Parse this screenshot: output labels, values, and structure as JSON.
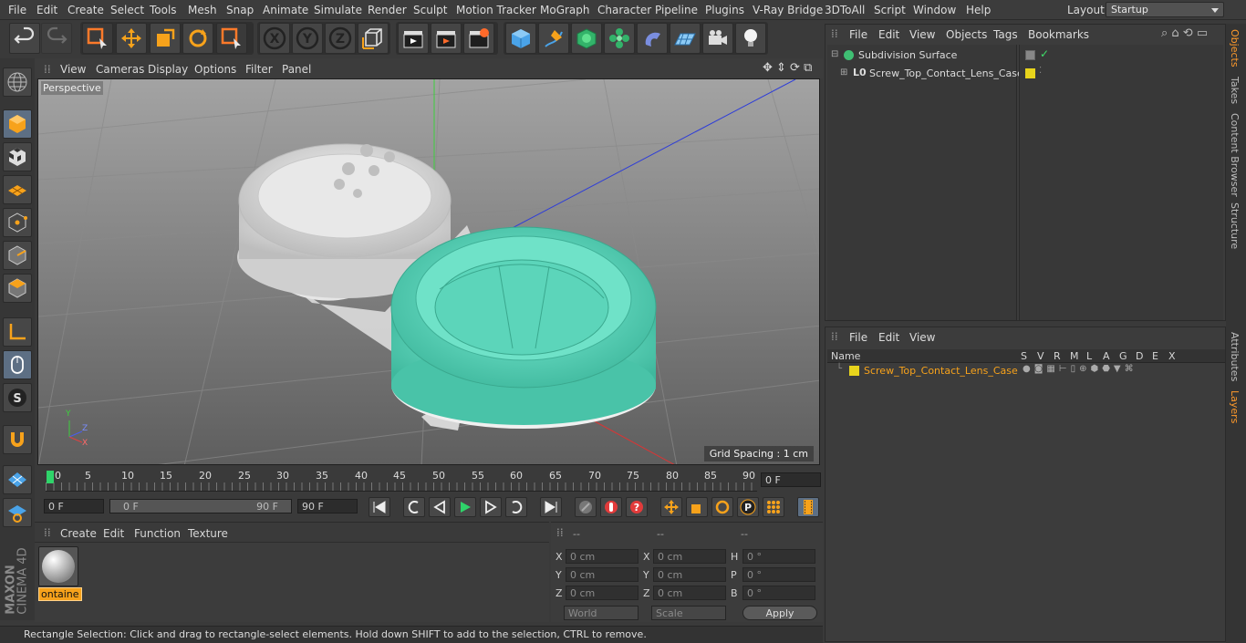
{
  "menubar": {
    "items": [
      "File",
      "Edit",
      "Create",
      "Select",
      "Tools",
      "Mesh",
      "Snap",
      "Animate",
      "Simulate",
      "Render",
      "Sculpt",
      "Motion Tracker",
      "MoGraph",
      "Character",
      "Pipeline",
      "Plugins",
      "V-Ray Bridge",
      "3DToAll",
      "Script",
      "Window",
      "Help"
    ],
    "layout_label": "Layout:",
    "layout_value": "Startup"
  },
  "viewport": {
    "menu": [
      "View",
      "Cameras",
      "Display",
      "Options",
      "Filter",
      "Panel"
    ],
    "label": "Perspective",
    "grid_spacing": "Grid Spacing : 1 cm",
    "axis_x": "X",
    "axis_y": "Y",
    "axis_z": "Z"
  },
  "timeline": {
    "ticks": [
      "0",
      "5",
      "10",
      "15",
      "20",
      "25",
      "30",
      "35",
      "40",
      "45",
      "50",
      "55",
      "60",
      "65",
      "70",
      "75",
      "80",
      "85",
      "90"
    ],
    "current_frame": "0 F",
    "start_field": "0 F",
    "range_start": "0 F",
    "range_end": "90 F",
    "end_field": "90 F"
  },
  "material": {
    "menu": [
      "Create",
      "Edit",
      "Function",
      "Texture"
    ],
    "item_label": "ontaine"
  },
  "coords": {
    "headers": [
      "--",
      "--",
      "--"
    ],
    "rows": [
      {
        "l1": "X",
        "v1": "0 cm",
        "l2": "X",
        "v2": "0 cm",
        "l3": "H",
        "v3": "0 °"
      },
      {
        "l1": "Y",
        "v1": "0 cm",
        "l2": "Y",
        "v2": "0 cm",
        "l3": "P",
        "v3": "0 °"
      },
      {
        "l1": "Z",
        "v1": "0 cm",
        "l2": "Z",
        "v2": "0 cm",
        "l3": "B",
        "v3": "0 °"
      }
    ],
    "world": "World",
    "scale": "Scale",
    "apply": "Apply"
  },
  "status": "Rectangle Selection: Click and drag to rectangle-select elements. Hold down SHIFT to add to the selection, CTRL to remove.",
  "objects": {
    "menu": [
      "File",
      "Edit",
      "View",
      "Objects",
      "Tags",
      "Bookmarks"
    ],
    "items": [
      "Subdivision Surface",
      "Screw_Top_Contact_Lens_Case"
    ]
  },
  "layers": {
    "menu": [
      "File",
      "Edit",
      "View"
    ],
    "columns": [
      "Name",
      "S",
      "V",
      "R",
      "M",
      "L",
      "A",
      "G",
      "D",
      "E",
      "X"
    ],
    "items": [
      "Screw_Top_Contact_Lens_Case"
    ]
  },
  "right_tabs": [
    "Objects",
    "Takes",
    "Content Browser",
    "Structure",
    "Attributes",
    "Layers"
  ],
  "logo": {
    "line1": "MAXON",
    "line2": "CINEMA 4D"
  },
  "colors": {
    "accent": "#ff9a2b",
    "layer": "#e8d41c",
    "teal": "#5fd9c0",
    "selection": "#5d6f84"
  }
}
